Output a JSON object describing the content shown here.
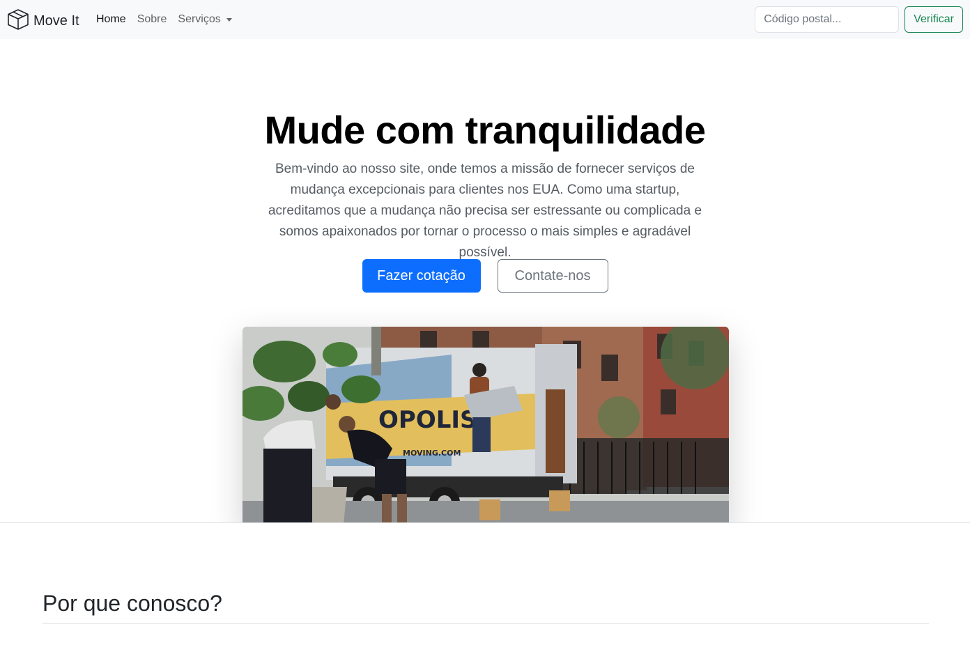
{
  "navbar": {
    "brand": "Move It",
    "links": [
      {
        "label": "Home",
        "active": true
      },
      {
        "label": "Sobre",
        "active": false
      },
      {
        "label": "Serviços",
        "active": false,
        "dropdown": true
      }
    ],
    "search": {
      "placeholder": "Código postal...",
      "value": ""
    },
    "verify_label": "Verificar"
  },
  "hero": {
    "title": "Mude com tranquilidade",
    "lead": "Bem-vindo ao nosso site, onde temos a missão de fornecer serviços de mudança excepcionais para clientes nos EUA. Como uma startup, acreditamos que a mudança não precisa ser estressante ou complicada e somos apaixonados por tornar o processo o mais simples e agradável possível.",
    "primary_button": "Fazer cotação",
    "secondary_button": "Contate-nos",
    "image_alt": "Movers loading a moving truck in front of brownstone buildings",
    "truck_text": "OPOLIS",
    "truck_site": "MOVING.COM"
  },
  "colors": {
    "primary": "#0d6efd",
    "success": "#198754",
    "secondary": "#6c757d",
    "navbar_bg": "#f8f9fa"
  },
  "section": {
    "title": "Por que conosco?"
  }
}
